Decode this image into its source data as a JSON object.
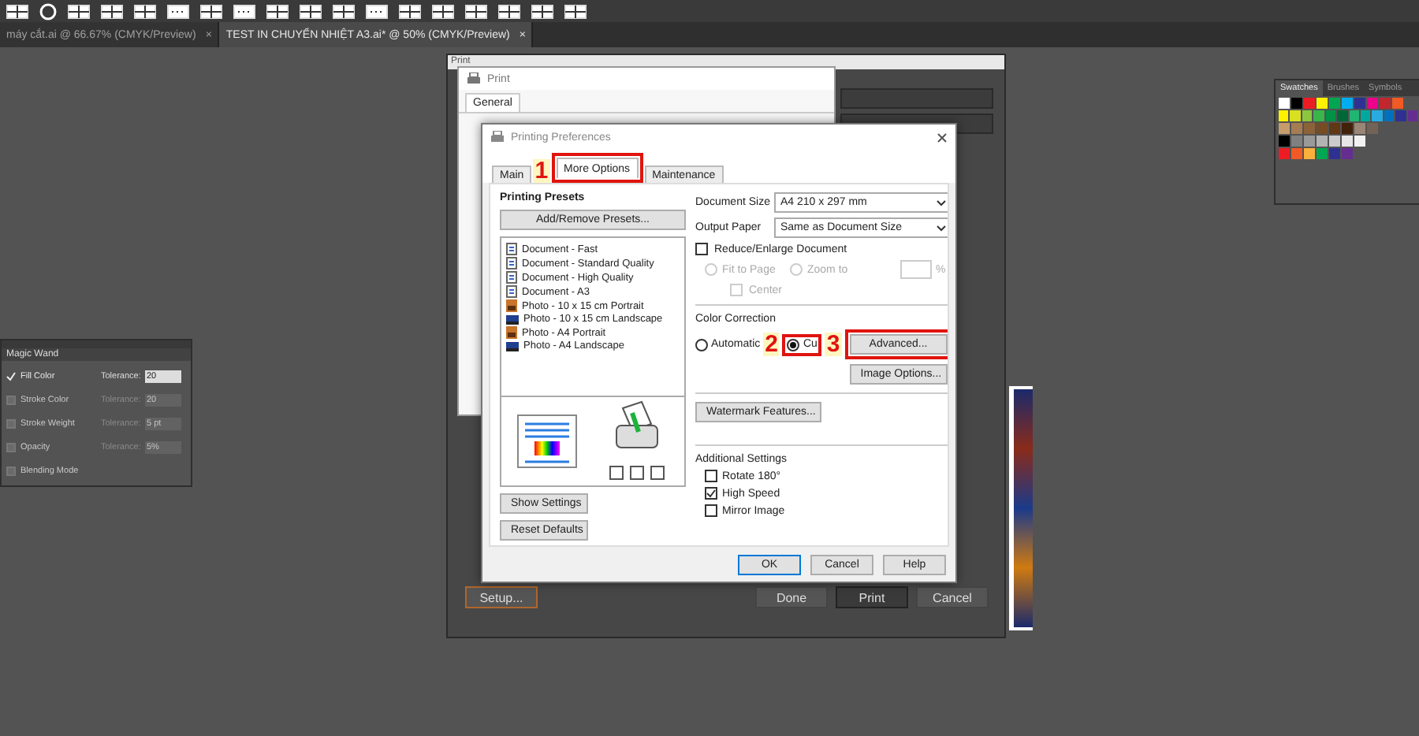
{
  "app_tabs": [
    {
      "label": "máy cắt.ai @ 66.67% (CMYK/Preview)",
      "close": "×",
      "selected": false
    },
    {
      "label": "TEST IN CHUYỂN NHIỆT A3.ai* @ 50% (CMYK/Preview)",
      "close": "×",
      "selected": true
    }
  ],
  "magic_wand": {
    "title": "Magic Wand",
    "rows": [
      {
        "label": "Fill Color",
        "checked": true,
        "tolerance_label": "Tolerance:",
        "value": "20"
      },
      {
        "label": "Stroke Color",
        "checked": false,
        "tolerance_label": "Tolerance:",
        "value": "20"
      },
      {
        "label": "Stroke Weight",
        "checked": false,
        "tolerance_label": "Tolerance:",
        "value": "5 pt"
      },
      {
        "label": "Opacity",
        "checked": false,
        "tolerance_label": "Tolerance:",
        "value": "5%"
      },
      {
        "label": "Blending Mode",
        "checked": false
      }
    ]
  },
  "swatches": {
    "tabs": [
      {
        "label": "Swatches",
        "selected": true
      },
      {
        "label": "Brushes",
        "selected": false
      },
      {
        "label": "Symbols",
        "selected": false
      }
    ],
    "rows": [
      {
        "swatches": [
          {
            "color": "#ffffff"
          },
          {
            "color": "#000000"
          },
          {
            "color": "#ed1c24"
          },
          {
            "color": "#fff200"
          },
          {
            "color": "#00a651"
          },
          {
            "color": "#00aeef"
          },
          {
            "color": "#2e3192"
          },
          {
            "color": "#ec008c"
          },
          {
            "color": "#c1272d"
          },
          {
            "color": "#f15a24"
          }
        ]
      },
      {
        "swatches": [
          {
            "color": "#fff200"
          },
          {
            "color": "#d9e021"
          },
          {
            "color": "#8cc63f"
          },
          {
            "color": "#39b54a"
          },
          {
            "color": "#009245"
          },
          {
            "color": "#006837"
          },
          {
            "color": "#22b573"
          },
          {
            "color": "#00a99d"
          },
          {
            "color": "#29abe2"
          },
          {
            "color": "#0071bc"
          },
          {
            "color": "#2e3192"
          },
          {
            "color": "#662d91"
          }
        ]
      },
      {
        "swatches": [
          {
            "color": "#c69c6d"
          },
          {
            "color": "#a67c52"
          },
          {
            "color": "#8c6239"
          },
          {
            "color": "#754c24"
          },
          {
            "color": "#603813"
          },
          {
            "color": "#42210b"
          },
          {
            "color": "#998675"
          },
          {
            "color": "#736357"
          }
        ]
      },
      {
        "swatches": [
          {
            "color": "#000000"
          },
          {
            "color": "#808080"
          },
          {
            "color": "#999999"
          },
          {
            "color": "#b3b3b3"
          },
          {
            "color": "#cccccc"
          },
          {
            "color": "#e6e6e6"
          },
          {
            "color": "#f2f2f2"
          }
        ]
      },
      {
        "swatches": [
          {
            "color": "#ed1c24"
          },
          {
            "color": "#f15a24"
          },
          {
            "color": "#fbb03b"
          },
          {
            "color": "#00a651"
          },
          {
            "color": "#2e3192"
          },
          {
            "color": "#662d91"
          }
        ]
      }
    ]
  },
  "ai_print": {
    "title": "Print",
    "setup": "Setup...",
    "buttons": [
      {
        "label": "Done",
        "selected": false
      },
      {
        "label": "Print",
        "selected": true
      },
      {
        "label": "Cancel",
        "selected": false
      }
    ]
  },
  "win_print": {
    "title": "Print",
    "tab": "General"
  },
  "prefs": {
    "title": "Printing Preferences",
    "tabs": [
      {
        "label": "Main",
        "selected": false
      },
      {
        "label": "More Options",
        "selected": true
      },
      {
        "label": "Maintenance",
        "selected": false
      }
    ],
    "presets_title": "Printing Presets",
    "add_remove": "Add/Remove Presets...",
    "presets": [
      {
        "label": "Document - Fast",
        "kind": "document"
      },
      {
        "label": "Document - Standard Quality",
        "kind": "document"
      },
      {
        "label": "Document - High Quality",
        "kind": "document"
      },
      {
        "label": "Document - A3",
        "kind": "document"
      },
      {
        "label": "Photo - 10 x 15 cm Portrait",
        "kind": "portrait"
      },
      {
        "label": "Photo - 10 x 15 cm Landscape",
        "kind": "landscape"
      },
      {
        "label": "Photo - A4 Portrait",
        "kind": "portrait"
      },
      {
        "label": "Photo - A4 Landscape",
        "kind": "landscape"
      }
    ],
    "show_settings": "Show Settings",
    "reset_defaults": "Reset Defaults",
    "document_size": {
      "label": "Document Size",
      "value": "A4 210 x 297 mm"
    },
    "output_paper": {
      "label": "Output Paper",
      "value": "Same as Document Size"
    },
    "reduce": {
      "label": "Reduce/Enlarge Document",
      "checked": false
    },
    "fit": {
      "label": "Fit to Page",
      "selected": false
    },
    "zoom": {
      "label": "Zoom to",
      "selected": false
    },
    "percent": "%",
    "center": {
      "label": "Center",
      "checked": false
    },
    "color_correction": "Color Correction",
    "automatic": {
      "label": "Automatic",
      "selected": false
    },
    "custom": {
      "label": "Cu",
      "selected": true
    },
    "advanced": "Advanced...",
    "image_options": "Image Options...",
    "watermark": "Watermark Features...",
    "additional": "Additional Settings",
    "settings": [
      {
        "label": "Rotate 180°",
        "checked": false
      },
      {
        "label": "High Speed",
        "checked": true
      },
      {
        "label": "Mirror Image",
        "checked": false
      }
    ],
    "buttons": [
      "OK",
      "Cancel",
      "Help"
    ],
    "markers": [
      "1",
      "2",
      "3"
    ]
  }
}
